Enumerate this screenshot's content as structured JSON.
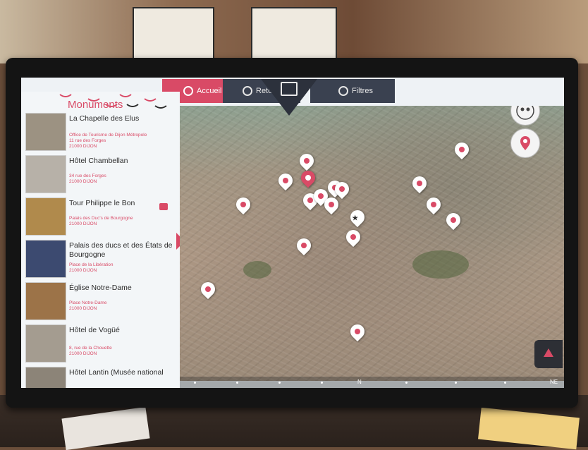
{
  "nav": {
    "home_label": "Accueil",
    "back_label": "Retour",
    "filters_label": "Filtres"
  },
  "panel": {
    "title": "Monuments",
    "items": [
      {
        "name": "La Chapelle des Elus",
        "address": "Office de Tourisme de Dijon Métropole\n11 rue des Forges\n21000 DIJON"
      },
      {
        "name": "Hôtel Chambellan",
        "address": "34 rue des Forges\n21000 DIJON"
      },
      {
        "name": "Tour Philippe le Bon",
        "address": "Palais des Duc's de Bourgogne\n21000 DIJON"
      },
      {
        "name": "Palais des ducs et des États de Bourgogne",
        "address": "Place de la Libération\n21000 DIJON"
      },
      {
        "name": "Église Notre-Dame",
        "address": "Place Notre-Dame\n21000 DIJON"
      },
      {
        "name": "Hôtel de Vogüé",
        "address": "8, rue de la Chouette\n21000 DIJON"
      },
      {
        "name": "Hôtel Lantin (Musée national",
        "address": ""
      }
    ]
  },
  "compass": {
    "north": "N",
    "northeast": "NE"
  },
  "colors": {
    "accent": "#d94a66",
    "dark": "#3a4150"
  }
}
